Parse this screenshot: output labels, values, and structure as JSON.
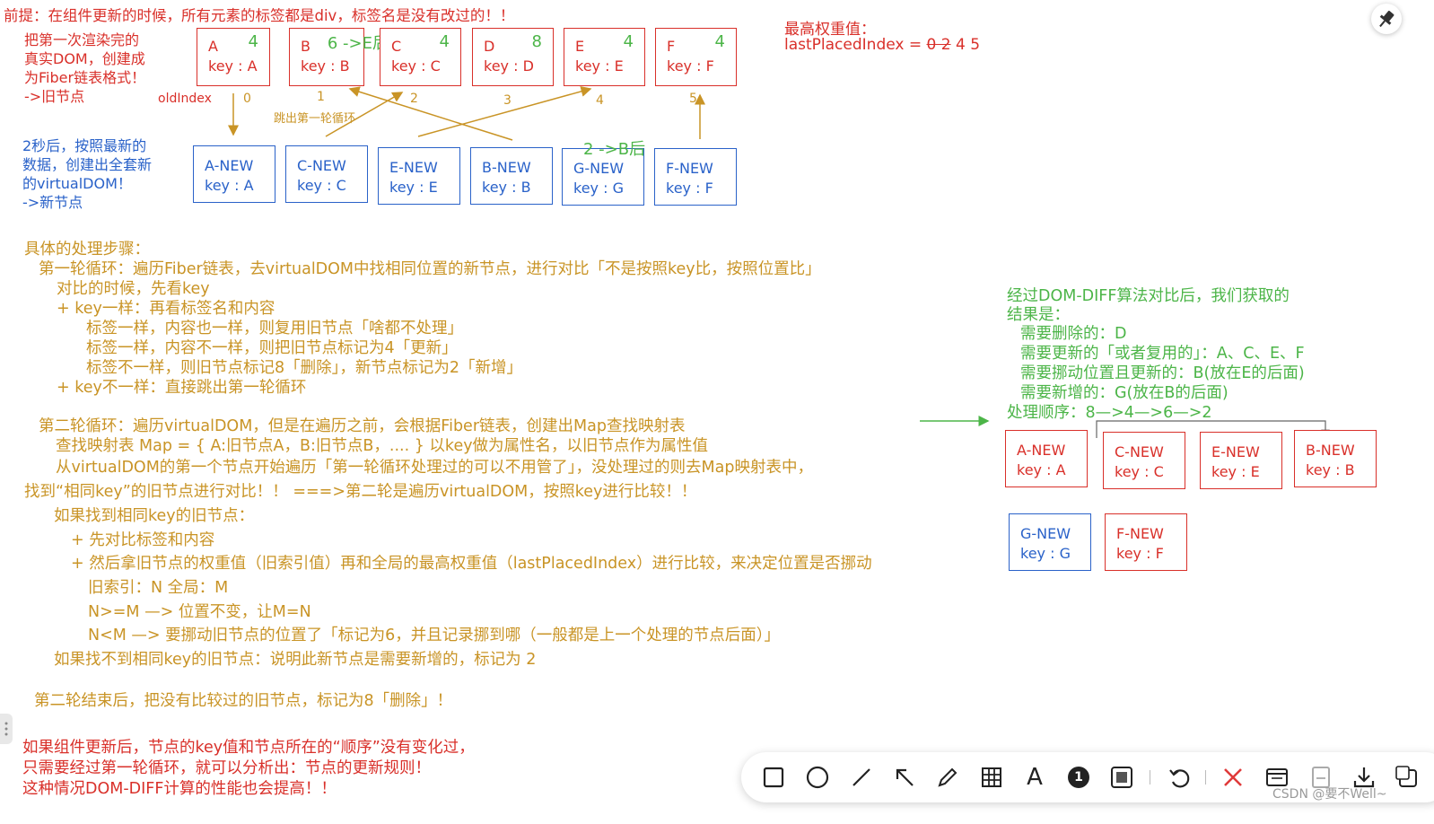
{
  "top_note": "前提：在组件更新的时候，所有元素的标签都是div，标签名是没有改过的！！",
  "left_notes": {
    "old_desc": [
      "把第一次渲染完的",
      "真实DOM，创建成",
      "为Fiber链表格式！",
      "->旧节点"
    ],
    "new_desc": [
      "2秒后，按照最新的",
      "数据，创建出全套新",
      "的virtualDOM！",
      "->新节点"
    ],
    "old_index_label": "oldIndex"
  },
  "old_nodes": [
    {
      "name": "A",
      "weight": "4",
      "key": "key : A",
      "index": "0"
    },
    {
      "name": "B",
      "weight": "6 ->E后",
      "key": "key : B",
      "index": "1"
    },
    {
      "name": "C",
      "weight": "4",
      "key": "key : C",
      "index": "2"
    },
    {
      "name": "D",
      "weight": "8",
      "key": "key : D",
      "index": "3"
    },
    {
      "name": "E",
      "weight": "4",
      "key": "key : E",
      "index": "4"
    },
    {
      "name": "F",
      "weight": "4",
      "key": "key : F",
      "index": "5"
    }
  ],
  "new_nodes": [
    {
      "name": "A-NEW",
      "key": "key : A"
    },
    {
      "name": "C-NEW",
      "key": "key : C"
    },
    {
      "name": "E-NEW",
      "key": "key : E"
    },
    {
      "name": "B-NEW",
      "key": "key : B"
    },
    {
      "name": "G-NEW",
      "key": "key : G"
    },
    {
      "name": "F-NEW",
      "key": "key : F"
    }
  ],
  "diagram_annotations": {
    "skip_first_loop": "跳出第一轮循环",
    "g_new_note": "2 ->B后"
  },
  "weights_box": {
    "title": "最高权重值：",
    "value_prefix": "lastPlacedIndex =",
    "struck": "0 2",
    "value_rest": "4  5"
  },
  "steps": [
    "具体的处理步骤：",
    "第一轮循环：遍历Fiber链表，去virtualDOM中找相同位置的新节点，进行对比「不是按照key比，按照位置比」",
    "对比的时候，先看key",
    "+ key一样：再看标签名和内容",
    "标签一样，内容也一样，则复用旧节点「啥都不处理」",
    "标签一样，内容不一样，则把旧节点标记为4「更新」",
    "标签不一样，则旧节点标记8「删除」，新节点标记为2「新增」",
    "+ key不一样：直接跳出第一轮循环",
    "第二轮循环：遍历virtualDOM，但是在遍历之前，会根据Fiber链表，创建出Map查找映射表",
    "查找映射表 Map = { A:旧节点A，B:旧节点B，.... }     以key做为属性名，以旧节点作为属性值",
    "从virtualDOM的第一个节点开始遍历「第一轮循环处理过的可以不用管了」，没处理过的则去Map映射表中，",
    "找到“相同key”的旧节点进行对比！！ ===>第二轮是遍历virtualDOM，按照key进行比较！！",
    "如果找到相同key的旧节点：",
    "+ 先对比标签和内容",
    "+ 然后拿旧节点的权重值（旧索引值）再和全局的最高权重值（lastPlacedIndex）进行比较，来决定位置是否挪动",
    "旧索引：N      全局：M",
    "N>=M —> 位置不变，让M=N",
    "N<M —> 要挪动旧节点的位置了「标记为6，并且记录挪到哪（一般都是上一个处理的节点后面）」",
    "如果找不到相同key的旧节点：说明此新节点是需要新增的，标记为 2",
    "第二轮结束后，把没有比较过的旧节点，标记为8「删除」！"
  ],
  "bottom_note": [
    "如果组件更新后，节点的key值和节点所在的“顺序”没有变化过，",
    "只需要经过第一轮循环，就可以分析出：节点的更新规则！",
    "这种情况DOM-DIFF计算的性能也会提高！！"
  ],
  "result": {
    "lines": [
      "经过DOM-DIFF算法对比后，我们获取的",
      "结果是：",
      "需要删除的：D",
      "需要更新的「或者复用的」：A、C、E、F",
      "需要挪动位置且更新的：B(放在E的后面)",
      "需要新增的：G(放在B的后面)",
      "处理顺序：8—>4—>6—>2"
    ],
    "nodes": [
      {
        "name": "A-NEW",
        "key": "key : A"
      },
      {
        "name": "C-NEW",
        "key": "key : C"
      },
      {
        "name": "E-NEW",
        "key": "key : E"
      },
      {
        "name": "B-NEW",
        "key": "key : B"
      },
      {
        "name": "G-NEW",
        "key": "key : G"
      },
      {
        "name": "F-NEW",
        "key": "key : F"
      }
    ]
  },
  "toolbar_items": [
    "square-icon",
    "circle-icon",
    "line-icon",
    "arrow-icon",
    "pen-icon",
    "table-icon",
    "text-icon",
    "number-icon",
    "mosaic-icon",
    "undo-icon",
    "close-icon",
    "screenshot-icon",
    "save-icon",
    "download-icon",
    "copy-icon"
  ],
  "toolbar_number_glyph": "1",
  "toolbar_text_glyph": "A",
  "watermark": "CSDN @要不Well~",
  "colors": {
    "red": "#d9302a",
    "blue": "#2a62c9",
    "orange": "#c99426",
    "green": "#4cb548"
  }
}
